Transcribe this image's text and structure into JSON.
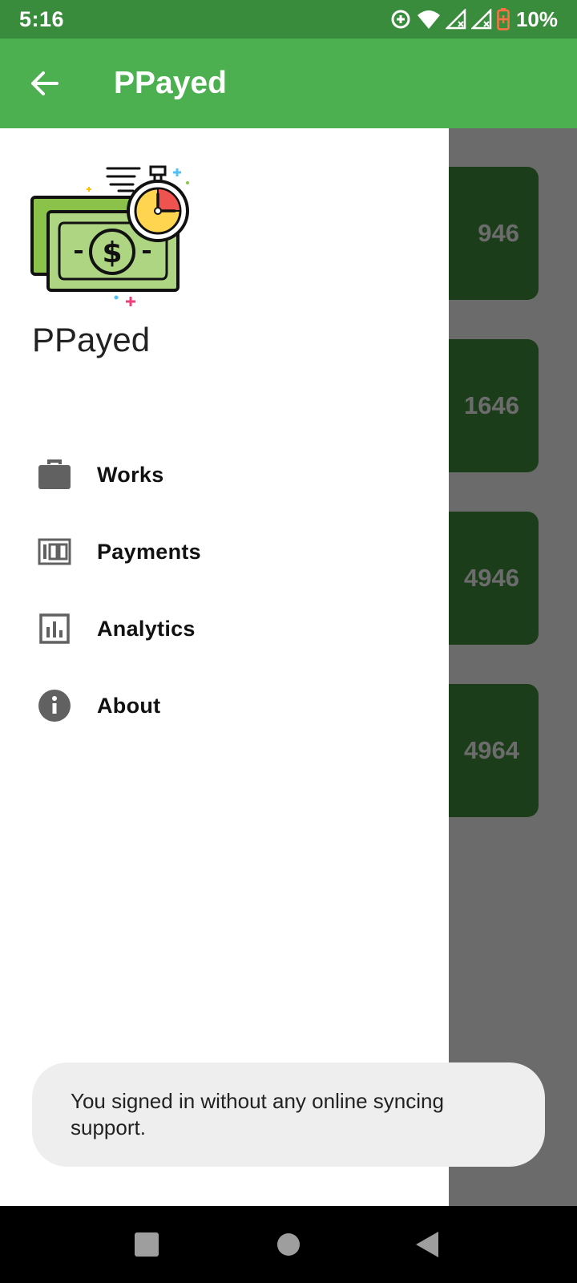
{
  "status_bar": {
    "time": "5:16",
    "battery_percent": "10%",
    "icons": [
      "sync-icon",
      "wifi-icon",
      "signal-icon",
      "signal-icon",
      "battery-low-icon"
    ]
  },
  "app_bar": {
    "title": "PPayed",
    "back_icon": "arrow-back-icon"
  },
  "background_cards": [
    {
      "value": "946"
    },
    {
      "value": "1646"
    },
    {
      "value": "4946"
    },
    {
      "value": "4964"
    }
  ],
  "drawer": {
    "app_name": "PPayed",
    "logo": "money-stopwatch-logo",
    "items": [
      {
        "label": "Works",
        "icon": "briefcase-icon"
      },
      {
        "label": "Payments",
        "icon": "payments-icon"
      },
      {
        "label": "Analytics",
        "icon": "analytics-icon"
      },
      {
        "label": "About",
        "icon": "info-icon"
      }
    ]
  },
  "snackbar": {
    "message": "You signed in without any online syncing support."
  },
  "nav_bar": {
    "buttons": [
      "recents-button",
      "home-button",
      "back-button"
    ]
  },
  "colors": {
    "status_bar": "#3a8c3d",
    "app_bar": "#4caf50",
    "card": "#1b3d19",
    "scrim": "#6b6b6b"
  }
}
